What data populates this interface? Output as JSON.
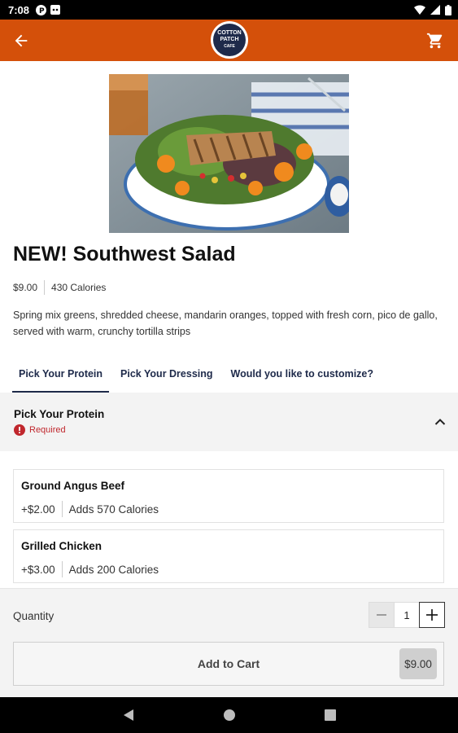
{
  "status_bar": {
    "time": "7:08"
  },
  "header": {
    "logo": {
      "line1": "COTTON",
      "line2": "PATCH",
      "line3": "CAFE"
    },
    "accent_color": "#d4500a",
    "back_icon": "arrow-back-icon",
    "cart_icon": "shopping-cart-icon"
  },
  "item": {
    "title": "NEW! Southwest Salad",
    "price": "$9.00",
    "calories": "430 Calories",
    "description": "Spring mix greens, shredded cheese, mandarin oranges, topped with fresh corn, pico de gallo, served with warm, crunchy tortilla strips"
  },
  "tabs": [
    {
      "label": "Pick Your Protein",
      "active": true
    },
    {
      "label": "Pick Your Dressing",
      "active": false
    },
    {
      "label": "Would you like to customize?",
      "active": false
    }
  ],
  "section": {
    "title": "Pick Your Protein",
    "required_label": "Required"
  },
  "options": [
    {
      "name": "Ground Angus Beef",
      "price": "+$2.00",
      "calories": "Adds 570 Calories"
    },
    {
      "name": "Grilled Chicken",
      "price": "+$3.00",
      "calories": "Adds 200 Calories"
    }
  ],
  "footer": {
    "quantity_label": "Quantity",
    "quantity_value": "1",
    "add_to_cart_label": "Add to Cart",
    "total_price": "$9.00"
  }
}
